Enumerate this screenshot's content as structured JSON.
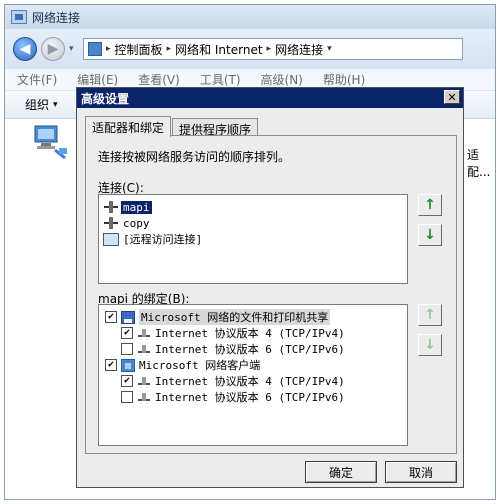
{
  "explorer": {
    "title": "网络连接",
    "address": {
      "segments": [
        "控制面板",
        "网络和 Internet",
        "网络连接"
      ]
    },
    "menu": [
      "文件(F)",
      "编辑(E)",
      "查看(V)",
      "工具(T)",
      "高级(N)",
      "帮助(H)"
    ],
    "command": {
      "organize": "组织"
    },
    "adapter_partial_text": "适配..."
  },
  "dialog": {
    "title": "高级设置",
    "close_label": "✕",
    "tabs": [
      {
        "label": "适配器和绑定",
        "active": true
      },
      {
        "label": "提供程序顺序",
        "active": false
      }
    ],
    "description": "连接按被网络服务访问的顺序排列。",
    "connections_label": "连接(C):",
    "connections": [
      {
        "label": "mapi",
        "selected": true,
        "icon": "network-connection-icon"
      },
      {
        "label": "copy",
        "selected": false,
        "icon": "network-connection-icon"
      },
      {
        "label": "[远程访问连接]",
        "selected": false,
        "icon": "remote-access-icon"
      }
    ],
    "bindings_label": "mapi 的绑定(B):",
    "bindings": [
      {
        "label": "Microsoft 网络的文件和打印机共享",
        "checked": true,
        "level": 0,
        "icon": "file-print-share-icon"
      },
      {
        "label": "Internet 协议版本 4 (TCP/IPv4)",
        "checked": true,
        "level": 1,
        "icon": "protocol-icon"
      },
      {
        "label": "Internet 协议版本 6 (TCP/IPv6)",
        "checked": false,
        "level": 1,
        "icon": "protocol-icon"
      },
      {
        "label": "Microsoft 网络客户端",
        "checked": true,
        "level": 0,
        "icon": "network-client-icon"
      },
      {
        "label": "Internet 协议版本 4 (TCP/IPv4)",
        "checked": true,
        "level": 1,
        "icon": "protocol-icon"
      },
      {
        "label": "Internet 协议版本 6 (TCP/IPv6)",
        "checked": false,
        "level": 1,
        "icon": "protocol-icon"
      }
    ],
    "up_arrow": "↑",
    "down_arrow": "↓",
    "ok_label": "确定",
    "cancel_label": "取消"
  },
  "colors": {
    "dialog_title_bg": "#0a246a",
    "selection_bg": "#0a246a",
    "arrow_green": "#1b8c2b"
  }
}
